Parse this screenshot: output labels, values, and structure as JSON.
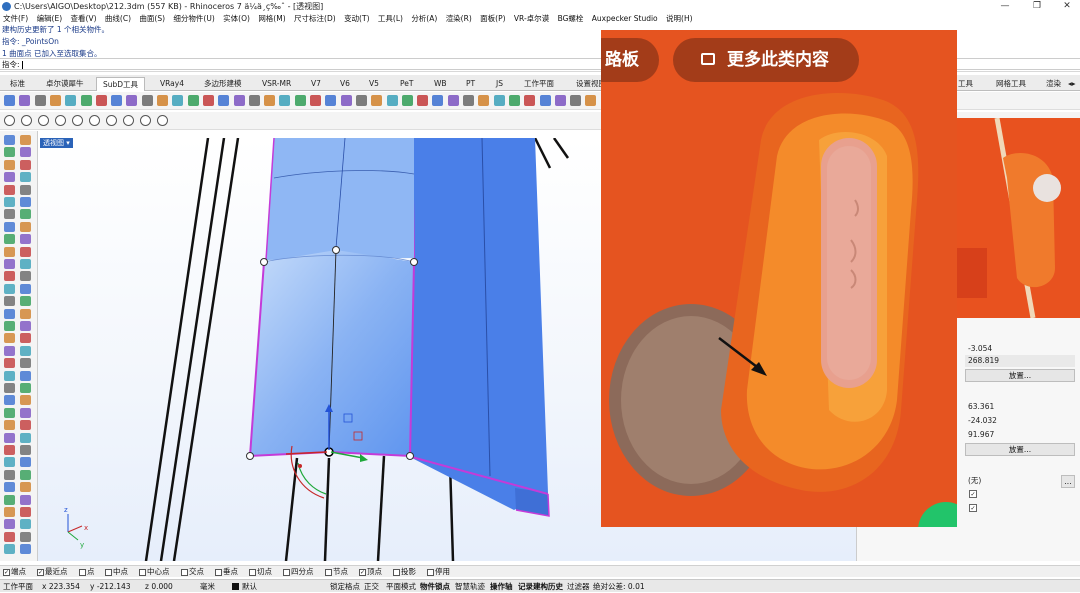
{
  "window": {
    "title": "C:\\Users\\AIGO\\Desktop\\212.3dm (557 KB) - Rhinoceros 7 ä¼ä¸ç‰ˆ - [透视图]",
    "controls": [
      "—",
      "❐",
      "✕"
    ]
  },
  "menu": [
    "文件(F)",
    "编辑(E)",
    "查看(V)",
    "曲线(C)",
    "曲面(S)",
    "细分物件(U)",
    "实体(O)",
    "网格(M)",
    "尺寸标注(D)",
    "变动(T)",
    "工具(L)",
    "分析(A)",
    "渲染(R)",
    "面板(P)",
    "VR-卓尔谟",
    "BG螺栓",
    "Auxpecker Studio",
    "说明(H)"
  ],
  "command": {
    "history": [
      "建构历史更新了 1 个相关物件。",
      "指令: _PointsOn",
      "1 曲面点 已加入至选取集合。"
    ],
    "prompt": "指令:"
  },
  "tabs": [
    {
      "label": "标准",
      "active": false
    },
    {
      "label": "卓尔谟犀牛",
      "active": false
    },
    {
      "label": "SubD工具",
      "active": true
    },
    {
      "label": "VRay4",
      "active": false
    },
    {
      "label": "多边形建模",
      "active": false
    },
    {
      "label": "VSR-MR",
      "active": false
    },
    {
      "label": "V7",
      "active": false
    },
    {
      "label": "V6",
      "active": false
    },
    {
      "label": "V5",
      "active": false
    },
    {
      "label": "PeT",
      "active": false
    },
    {
      "label": "WB",
      "active": false
    },
    {
      "label": "PT",
      "active": false
    },
    {
      "label": "JS",
      "active": false
    },
    {
      "label": "工作平面",
      "active": false
    },
    {
      "label": "设置视图",
      "active": false
    }
  ],
  "tabs_right": [
    "工具",
    "网格工具",
    "渲染"
  ],
  "viewport": {
    "label": "透视图",
    "axis": {
      "x": "x",
      "y": "y",
      "z": "z"
    }
  },
  "properties": {
    "values": [
      "-3.054",
      "268.819",
      "63.361",
      "-24.032",
      "91.967"
    ],
    "place_button": "放置...",
    "material_value": "(无)",
    "browse_button": "..."
  },
  "overlay": {
    "pill_left": "路板",
    "pill_right": "更多此类内容"
  },
  "osnaps": [
    {
      "label": "端点",
      "checked": true
    },
    {
      "label": "最近点",
      "checked": true
    },
    {
      "label": "点",
      "checked": false
    },
    {
      "label": "中点",
      "checked": false
    },
    {
      "label": "中心点",
      "checked": false
    },
    {
      "label": "交点",
      "checked": false
    },
    {
      "label": "垂点",
      "checked": false
    },
    {
      "label": "切点",
      "checked": false
    },
    {
      "label": "四分点",
      "checked": false
    },
    {
      "label": "节点",
      "checked": false
    },
    {
      "label": "顶点",
      "checked": true
    },
    {
      "label": "投影",
      "checked": false
    },
    {
      "label": "停用",
      "checked": false
    }
  ],
  "status": {
    "cplane": "工作平面",
    "x": "x 223.354",
    "y": "y -212.143",
    "z": "z 0.000",
    "units": "毫米",
    "layer": "默认",
    "lock_grid": "锁定格点",
    "ortho": "正交",
    "planar": "平面模式",
    "osnap": "物件锁点",
    "smarttrack": "智慧轨迹",
    "gumball": "操作轴",
    "history": "记录建构历史",
    "filter": "过滤器",
    "tolerance": "绝对公差: 0.01"
  }
}
